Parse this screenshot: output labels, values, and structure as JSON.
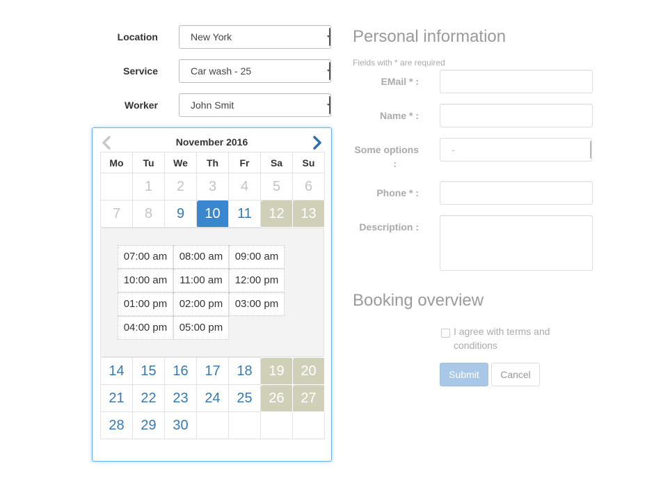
{
  "booking": {
    "location_label": "Location",
    "location_value": "New York",
    "service_label": "Service",
    "service_value": "Car wash - 25",
    "worker_label": "Worker",
    "worker_value": "John Smit"
  },
  "calendar": {
    "month_title": "November 2016",
    "weekdays": [
      "Mo",
      "Tu",
      "We",
      "Th",
      "Fr",
      "Sa",
      "Su"
    ],
    "week1": [
      "",
      "1",
      "2",
      "3",
      "4",
      "5",
      "6"
    ],
    "week2": [
      "7",
      "8",
      "9",
      "10",
      "11",
      "12",
      "13"
    ],
    "week3": [
      "14",
      "15",
      "16",
      "17",
      "18",
      "19",
      "20"
    ],
    "week4": [
      "21",
      "22",
      "23",
      "24",
      "25",
      "26",
      "27"
    ],
    "week5": [
      "28",
      "29",
      "30",
      "",
      "",
      "",
      ""
    ],
    "selected_day": "10",
    "time_slots": [
      "07:00 am",
      "08:00 am",
      "09:00 am",
      "10:00 am",
      "11:00 am",
      "12:00 pm",
      "01:00 pm",
      "02:00 pm",
      "03:00 pm",
      "04:00 pm",
      "05:00 pm"
    ],
    "colors": {
      "selected": "#3a87d0",
      "weekend": "#d0d0b8",
      "link": "#337ab7"
    }
  },
  "personal": {
    "heading": "Personal information",
    "required_note": "Fields with * are required",
    "email_label": "EMail * :",
    "name_label": "Name * :",
    "options_label_line1": "Some options",
    "options_label_line2": ":",
    "options_value": "-",
    "phone_label": "Phone * :",
    "description_label": "Description :"
  },
  "overview": {
    "heading": "Booking overview",
    "agree_text": "I agree with terms and conditions",
    "submit_label": "Submit",
    "cancel_label": "Cancel"
  }
}
